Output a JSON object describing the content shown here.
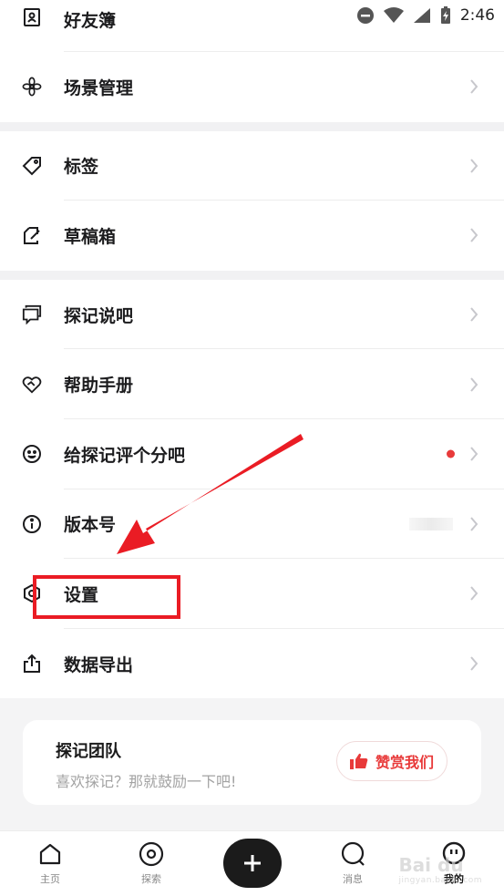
{
  "status_bar": {
    "time": "2:46"
  },
  "menu_groups": [
    [
      {
        "icon": "contacts-book-icon",
        "label": "好友簿"
      },
      {
        "icon": "flower-scene-icon",
        "label": "场景管理"
      }
    ],
    [
      {
        "icon": "tag-icon",
        "label": "标签"
      },
      {
        "icon": "draft-edit-icon",
        "label": "草稿箱"
      }
    ],
    [
      {
        "icon": "chat-bubble-icon",
        "label": "探记说吧"
      },
      {
        "icon": "heart-handshake-icon",
        "label": "帮助手册"
      },
      {
        "icon": "smiley-icon",
        "label": "给探记评个分吧",
        "has_dot": true
      },
      {
        "icon": "info-icon",
        "label": "版本号"
      },
      {
        "icon": "hexagon-settings-icon",
        "label": "设置"
      },
      {
        "icon": "share-export-icon",
        "label": "数据导出"
      }
    ]
  ],
  "team_card": {
    "title": "探记团队",
    "subtitle": "喜欢探记？那就鼓励一下吧!",
    "button_label": "赞赏我们"
  },
  "tabbar": {
    "home": "主页",
    "explore": "探索",
    "messages": "消息",
    "mine": "我的"
  },
  "watermark": {
    "brand": "Bai du",
    "url": "jingyan.baidu.com"
  },
  "colors": {
    "accent": "#e83a3a",
    "annotation": "#ea1c24",
    "fab": "#1b1b1b"
  }
}
